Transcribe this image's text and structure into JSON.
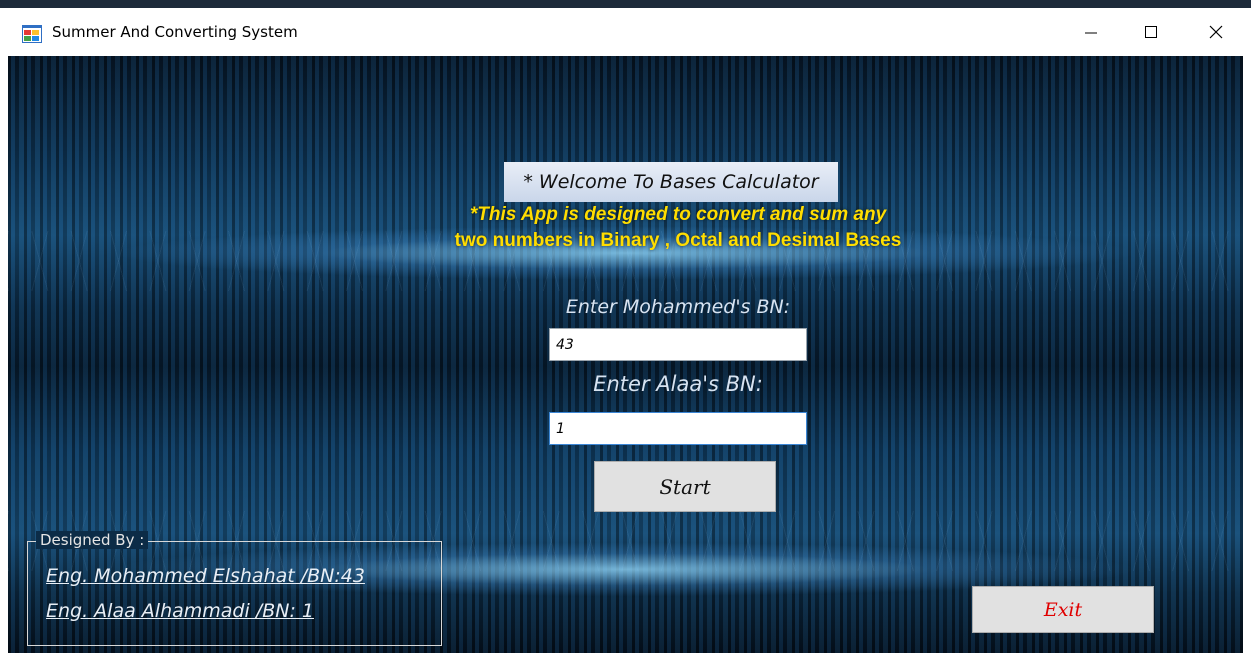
{
  "window": {
    "title": "Summer And Converting System",
    "controls": [
      "minimize",
      "maximize",
      "close"
    ]
  },
  "header": {
    "welcome": "* Welcome To Bases Calculator",
    "description_line1": "*This App is designed to convert and sum any",
    "description_line2": "two numbers in Binary , Octal and Desimal Bases"
  },
  "form": {
    "field1_label": "Enter Mohammed's BN:",
    "field1_value": "43",
    "field2_label": "Enter Alaa's BN:",
    "field2_value": "1",
    "start_label": "Start"
  },
  "credits": {
    "legend": "Designed By :",
    "line1": "Eng. Mohammed Elshahat /BN:43",
    "line2": "Eng. Alaa Alhammadi  /BN: 1"
  },
  "exit_label": "Exit",
  "colors": {
    "accent_text": "#ffdd00",
    "exit_text": "#e00000",
    "background": "#174b73"
  }
}
